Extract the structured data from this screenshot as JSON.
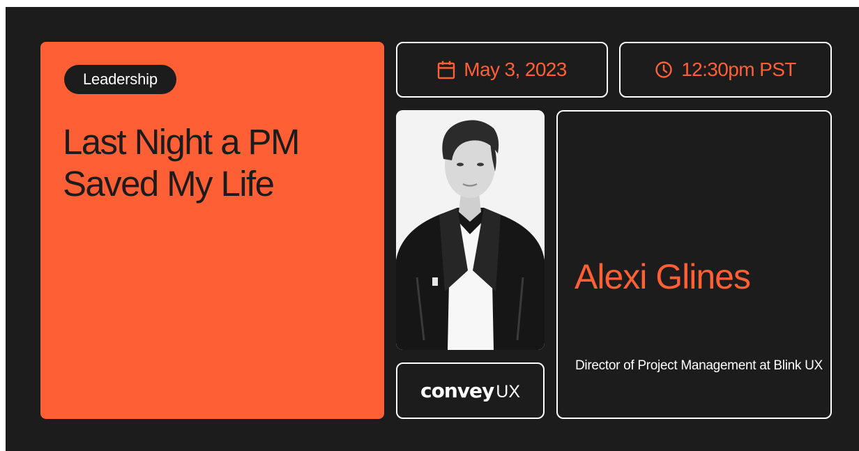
{
  "event": {
    "tag": "Leadership",
    "title": "Last Night a PM Saved My Life",
    "date": "May 3, 2023",
    "time": "12:30pm PST"
  },
  "speaker": {
    "name": "Alexi Glines",
    "role": "Director of Project Management at Blink UX",
    "photo_icon": "speaker-portrait"
  },
  "brand": {
    "logo_bold": "convey",
    "logo_light": "UX"
  },
  "colors": {
    "background": "#1c1c1c",
    "accent": "#ff5f35",
    "text_light": "#ffffff",
    "border": "#ffffff"
  },
  "icons": {
    "date": "calendar-icon",
    "time": "clock-icon"
  }
}
